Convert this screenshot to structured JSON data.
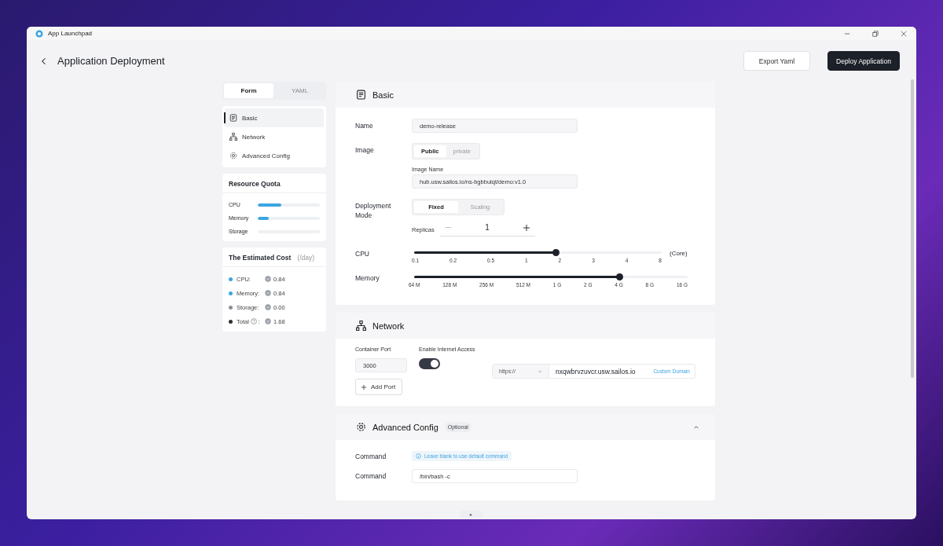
{
  "window": {
    "title": "App Launchpad"
  },
  "header": {
    "title": "Application Deployment",
    "buttons": [
      {
        "label": "Export Yaml",
        "kind": "secondary"
      },
      {
        "label": "Deploy Application",
        "kind": "primary"
      }
    ]
  },
  "view_tabs": [
    {
      "label": "Form",
      "selected": true
    },
    {
      "label": "YAML",
      "selected": false
    }
  ],
  "nav": [
    {
      "label": "Basic",
      "selected": true
    },
    {
      "label": "Network",
      "selected": false
    },
    {
      "label": "Advanced Config",
      "selected": false
    }
  ],
  "resource_quota": {
    "title": "Resource Quota",
    "items": [
      {
        "label": "CPU",
        "level": 0.38
      },
      {
        "label": "Memory",
        "level": 0.18
      },
      {
        "label": "Storage",
        "level": 0
      }
    ]
  },
  "cost": {
    "title": "The Estimated Cost",
    "unit": "(/day)",
    "items": [
      {
        "label": "CPU:",
        "value": "0.84",
        "color": "#3ba6e0",
        "help": false
      },
      {
        "label": "Memory:",
        "value": "0.84",
        "color": "#3ba6e0",
        "help": false
      },
      {
        "label": "Storage:",
        "value": "0.00",
        "color": "#8a8f98",
        "help": false
      },
      {
        "label": "Total",
        "colon": ":",
        "value": "1.68",
        "color": "#2b2f36",
        "help": true
      }
    ]
  },
  "basic": {
    "title": "Basic",
    "name": {
      "label": "Name",
      "value": "demo-release"
    },
    "image": {
      "label": "Image",
      "options": [
        {
          "label": "Public",
          "selected": true
        },
        {
          "label": "private",
          "selected": false
        }
      ],
      "sublabel": "Image Name",
      "value": "hub.usw.sailos.io/ns-bgbbulqt/demo:v1.0"
    },
    "mode": {
      "label": "Deployment Mode",
      "options": [
        {
          "label": "Fixed",
          "selected": true
        },
        {
          "label": "Scaling",
          "selected": false
        }
      ],
      "replicas": {
        "label": "Replicas",
        "value": "1"
      }
    },
    "cpu": {
      "label": "CPU",
      "ticks": [
        "0.1",
        "0.2",
        "0.5",
        "1",
        "2",
        "3",
        "4",
        "8"
      ],
      "level": 0.571,
      "unit": "(Core)"
    },
    "memory": {
      "label": "Memory",
      "ticks": [
        "64 M",
        "128 M",
        "256 M",
        "512 M",
        "1 G",
        "2 G",
        "4 G",
        "8 G",
        "16 G"
      ],
      "level": 0.75
    }
  },
  "network": {
    "title": "Network",
    "port": {
      "label": "Container Port",
      "value": "3000"
    },
    "internet": {
      "label": "Enable Internet Access",
      "on": true
    },
    "protocol": "https://",
    "domain": "nxqwbrvzuvcr.usw.sailos.io",
    "custom_domain": "Custom Domain",
    "add_port": "Add Port"
  },
  "advanced": {
    "title": "Advanced Config",
    "badge": "Optional",
    "expanded": true,
    "rows": [
      {
        "label": "Command",
        "kind": "hint",
        "text": "Leave blank to use default command"
      },
      {
        "label": "Command",
        "kind": "input",
        "value": "/bin/bash -c"
      }
    ]
  }
}
